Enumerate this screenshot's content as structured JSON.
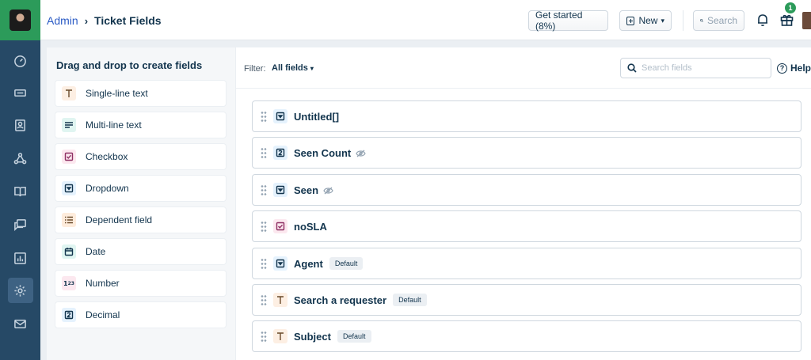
{
  "breadcrumb": {
    "parent": "Admin",
    "current": "Ticket Fields"
  },
  "header": {
    "get_started": "Get started (8%)",
    "new_label": "New",
    "search_placeholder": "Search",
    "gift_badge": "1"
  },
  "nav_icons": [
    "dashboard-icon",
    "tickets-icon",
    "contacts-icon",
    "social-icon",
    "solutions-icon",
    "forums-icon",
    "reports-icon",
    "admin-gear-icon",
    "mail-icon"
  ],
  "palette": {
    "title": "Drag and drop to create fields",
    "items": [
      {
        "label": "Single-line text",
        "icon": "text-icon"
      },
      {
        "label": "Multi-line text",
        "icon": "paragraph-icon"
      },
      {
        "label": "Checkbox",
        "icon": "checkbox-icon"
      },
      {
        "label": "Dropdown",
        "icon": "dropdown-icon"
      },
      {
        "label": "Dependent field",
        "icon": "dependent-list-icon"
      },
      {
        "label": "Date",
        "icon": "calendar-icon"
      },
      {
        "label": "Number",
        "icon": "number-icon"
      },
      {
        "label": "Decimal",
        "icon": "decimal-icon"
      }
    ]
  },
  "filter": {
    "label": "Filter:",
    "value": "All fields",
    "search_placeholder": "Search fields",
    "help": "Help"
  },
  "fields": [
    {
      "name": "Untitled[]",
      "type": "dropdown"
    },
    {
      "name": "Seen Count",
      "type": "number",
      "hidden": true
    },
    {
      "name": "Seen",
      "type": "dropdown",
      "hidden": true
    },
    {
      "name": "noSLA",
      "type": "checkbox"
    },
    {
      "name": "Agent",
      "type": "dropdown",
      "badge": "Default"
    },
    {
      "name": "Search a requester",
      "type": "text",
      "badge": "Default"
    },
    {
      "name": "Subject",
      "type": "text",
      "badge": "Default"
    }
  ],
  "colors": {
    "brand_green": "#2c9b5a",
    "rail": "#264966",
    "link": "#2c5cc5"
  }
}
